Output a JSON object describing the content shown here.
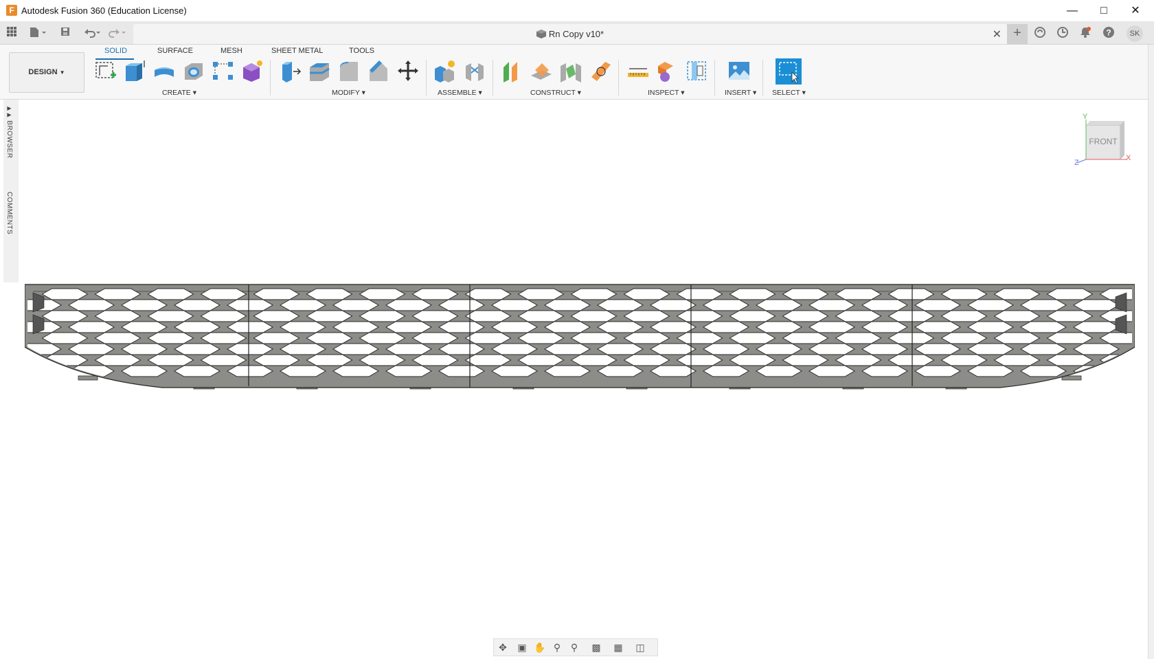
{
  "window": {
    "title": "Autodesk Fusion 360 (Education License)",
    "app_icon_letter": "F",
    "controls": [
      "minimize-icon",
      "maximize-icon",
      "close-icon"
    ]
  },
  "document": {
    "title": "Rn Copy v10*",
    "close_glyph": "✕"
  },
  "quick_access": {
    "icons": [
      "grid-apps-icon",
      "file-icon",
      "save-icon",
      "undo-icon",
      "redo-icon"
    ]
  },
  "header_right": {
    "icons": [
      "add-tab-icon",
      "job-status-icon",
      "history-icon",
      "notifications-icon",
      "help-icon"
    ],
    "user_initials": "SK"
  },
  "workspace": {
    "label": "DESIGN"
  },
  "ribbon": {
    "tabs": [
      {
        "label": "SOLID",
        "active": true
      },
      {
        "label": "SURFACE",
        "active": false
      },
      {
        "label": "MESH",
        "active": false
      },
      {
        "label": "SHEET METAL",
        "active": false
      },
      {
        "label": "TOOLS",
        "active": false
      }
    ],
    "groups": [
      {
        "label": "CREATE",
        "tools": [
          "create-sketch-icon",
          "extrude-icon",
          "revolve-icon",
          "hole-icon",
          "pattern-icon",
          "create-form-icon"
        ]
      },
      {
        "label": "MODIFY",
        "tools": [
          "press-pull-icon",
          "shell-icon",
          "fillet-icon",
          "chamfer-icon",
          "move-icon"
        ]
      },
      {
        "label": "ASSEMBLE",
        "tools": [
          "new-component-icon",
          "joint-icon"
        ]
      },
      {
        "label": "CONSTRUCT",
        "tools": [
          "offset-plane-icon",
          "plane-at-angle-icon",
          "midplane-icon",
          "tangent-plane-icon"
        ]
      },
      {
        "label": "INSPECT",
        "tools": [
          "measure-icon",
          "interference-icon",
          "section-analysis-icon"
        ]
      },
      {
        "label": "INSERT",
        "tools": [
          "insert-image-icon"
        ]
      },
      {
        "label": "SELECT",
        "tools": [
          "window-select-icon"
        ]
      }
    ]
  },
  "side_panel": {
    "browser_label": "BROWSER",
    "comments_label": "COMMENTS"
  },
  "viewcube": {
    "face": "FRONT",
    "axes": {
      "x": "X",
      "y": "Y",
      "z": "Z"
    }
  },
  "navigation_bar": {
    "icons": [
      "orbit-icon",
      "look-at-icon",
      "pan-icon",
      "zoom-icon",
      "fit-icon",
      "display-settings-icon",
      "grid-settings-icon",
      "viewports-icon"
    ]
  },
  "colors": {
    "accent": "#1a6fb3",
    "select_blue": "#1a8fd6",
    "model_gray": "#8c8c88"
  }
}
